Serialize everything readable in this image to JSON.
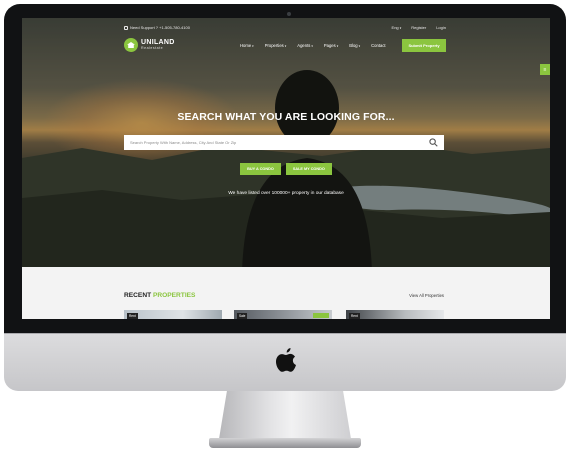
{
  "topbar": {
    "phone": "Need Support ? +1-505-780-4100",
    "lang": "Eng",
    "register": "Register",
    "login": "Login"
  },
  "logo": {
    "name": "UNILAND",
    "sub": "Realestate"
  },
  "nav": {
    "items": [
      "Home",
      "Properties",
      "Agents",
      "Pages",
      "Blog",
      "Contact"
    ],
    "submit": "Submit Property"
  },
  "hero": {
    "headline": "SEARCH WHAT YOU ARE LOOKING FOR...",
    "search_placeholder": "Search Property With Name, Address, City And State Or Zip",
    "buy_button": "BUY A CONDO",
    "sale_button": "SALE MY CONDO",
    "note": "We have listed over 100000+ property in our database"
  },
  "recent": {
    "title_prefix": "RECENT",
    "title_accent": "PROPERTIES",
    "view_all": "View All Properties",
    "tags": [
      "Rent",
      "Sale",
      "Rent"
    ]
  },
  "colors": {
    "accent": "#8bc53f",
    "dark": "#222222"
  },
  "icons": {
    "search": "search-icon",
    "phone": "phone-icon",
    "brand": "apple-logo"
  }
}
